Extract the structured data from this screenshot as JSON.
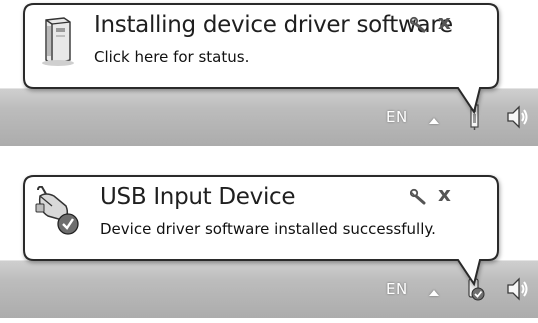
{
  "notifications": [
    {
      "title": "Installing device driver software",
      "body": "Click here for status.",
      "icon": "device-installer-icon"
    },
    {
      "title": "USB Input Device",
      "body": "Device driver software installed successfully.",
      "icon": "usb-mouse-device-icon"
    }
  ],
  "balloon_controls": {
    "options_icon": "wrench-icon",
    "close_glyph": "x"
  },
  "taskbar": {
    "language": "EN",
    "show_hidden_icon": "chevron-up-icon",
    "tray_icons": [
      "driver-install-tray-icon",
      "speaker-icon"
    ]
  }
}
